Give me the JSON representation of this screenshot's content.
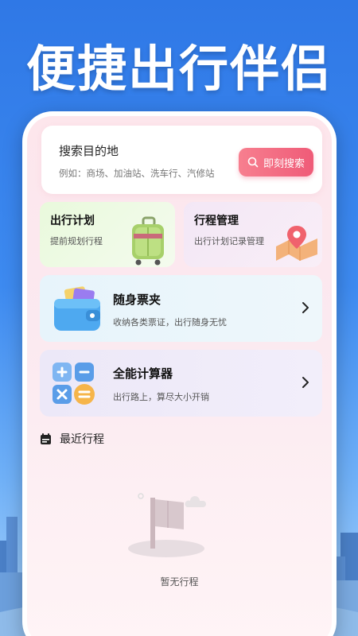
{
  "promo": {
    "title": "便捷出行伴侣"
  },
  "search": {
    "title": "搜索目的地",
    "hint": "例如：商场、加油站、洗车行、汽修站",
    "button_label": "即刻搜索"
  },
  "features": {
    "plan": {
      "title": "出行计划",
      "subtitle": "提前规划行程"
    },
    "trip": {
      "title": "行程管理",
      "subtitle": "出行计划记录管理"
    },
    "ticket": {
      "title": "随身票夹",
      "subtitle": "收纳各类票证，出行随身无忧"
    },
    "calc": {
      "title": "全能计算器",
      "subtitle": "出行路上，算尽大小开销"
    }
  },
  "recent": {
    "title": "最近行程",
    "empty_text": "暂无行程"
  },
  "colors": {
    "accent": "#ef5b78",
    "background": "#3d8af0"
  },
  "icons": [
    "search-icon",
    "luggage-icon",
    "map-pin-icon",
    "wallet-icon",
    "calculator-icon",
    "chevron-right-icon",
    "calendar-icon",
    "empty-flag-icon"
  ]
}
